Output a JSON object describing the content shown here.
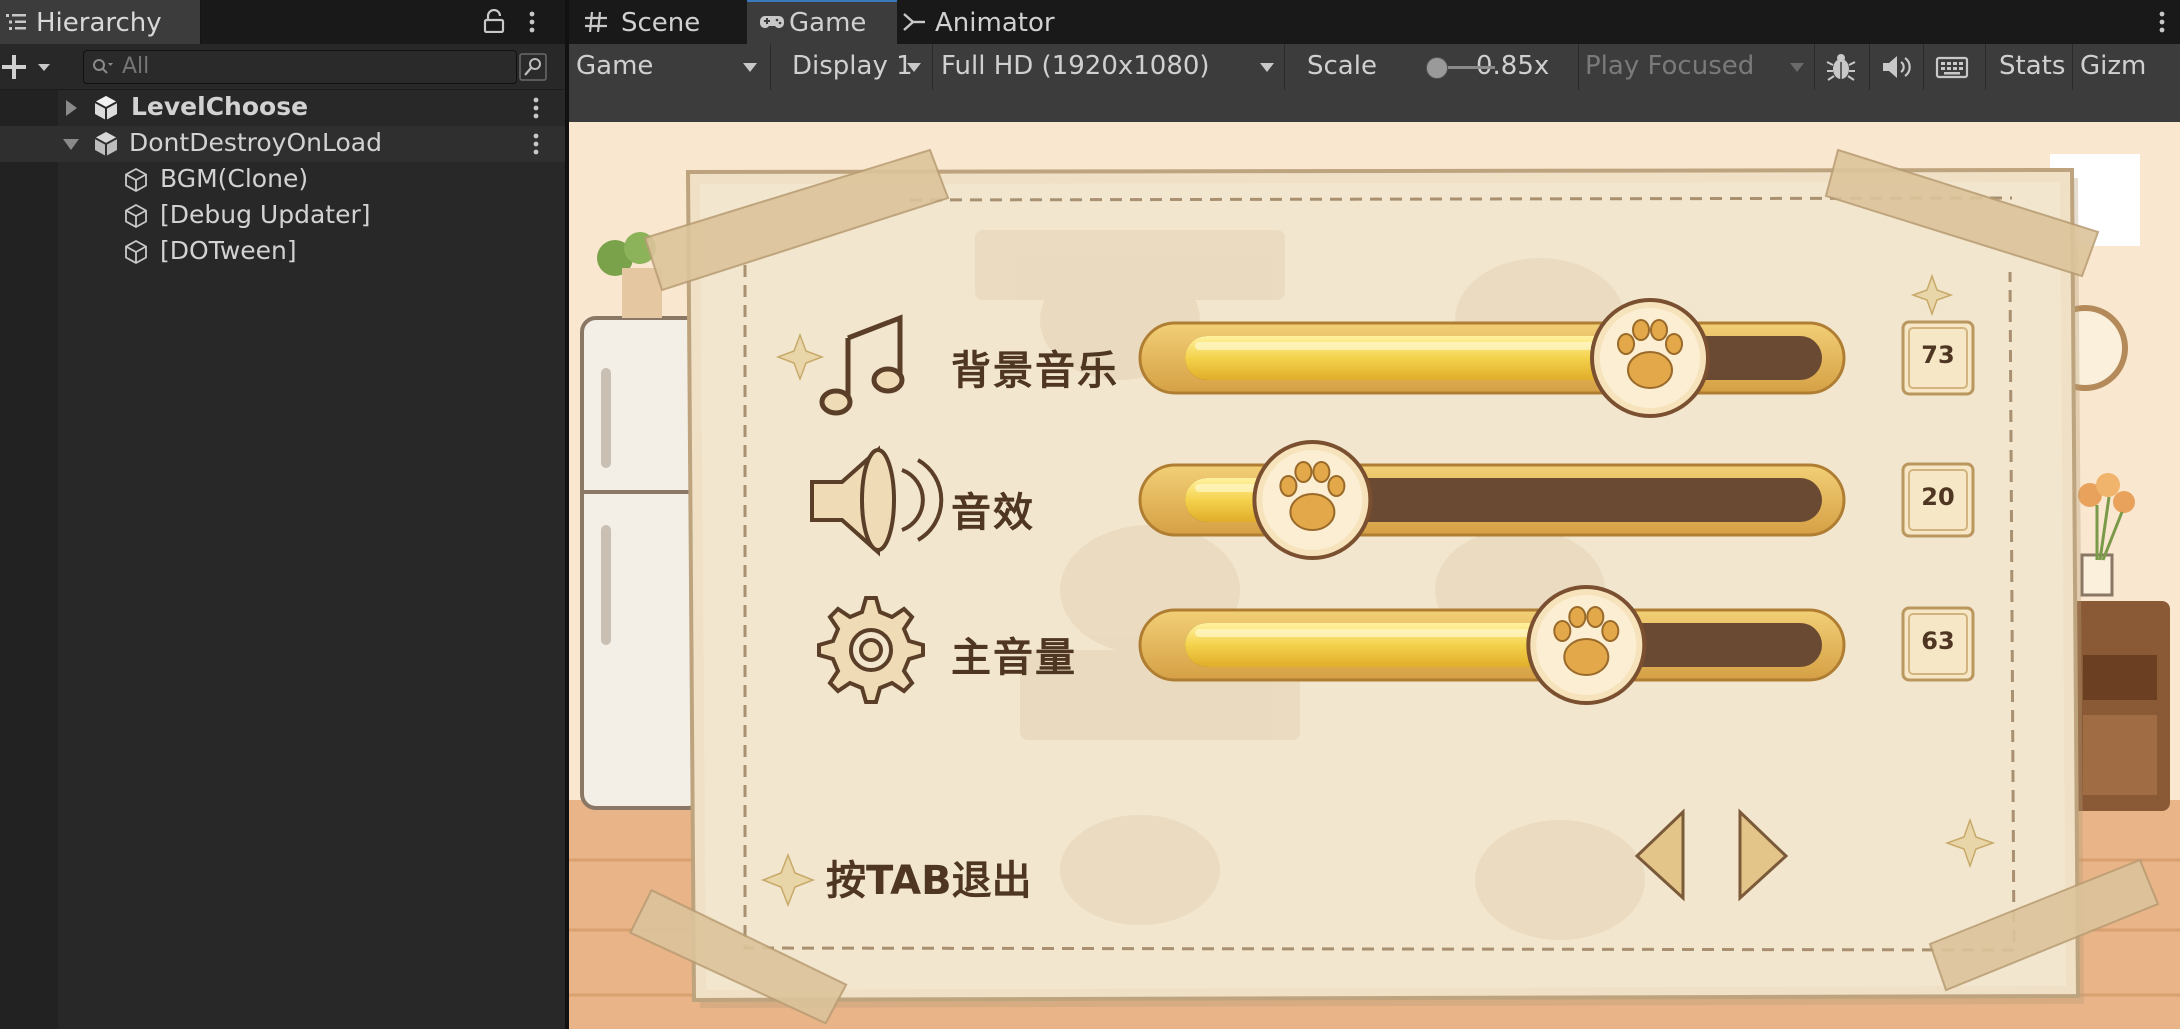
{
  "hierarchy": {
    "tab_label": "Hierarchy",
    "search_placeholder": "All",
    "items": [
      {
        "name": "LevelChoose",
        "expanded": false,
        "bold": true
      },
      {
        "name": "DontDestroyOnLoad",
        "expanded": true,
        "bold": false,
        "children": [
          "BGM(Clone)",
          "[Debug Updater]",
          "[DOTween]"
        ]
      }
    ]
  },
  "tabs": {
    "scene": "Scene",
    "game": "Game",
    "animator": "Animator",
    "active": "Game"
  },
  "game_toolbar": {
    "view_mode": "Game",
    "display": "Display 1",
    "resolution": "Full HD (1920x1080)",
    "scale_label": "Scale",
    "scale_value": "0.85x",
    "play_mode": "Play Focused",
    "stats": "Stats",
    "gizmos": "Gizm"
  },
  "settings_panel": {
    "settings": [
      {
        "label": "背景音乐",
        "value": 73,
        "icon": "music-note-icon"
      },
      {
        "label": "音效",
        "value": 20,
        "icon": "speaker-icon"
      },
      {
        "label": "主音量",
        "value": 63,
        "icon": "gear-icon"
      }
    ],
    "exit_hint": "按TAB退出",
    "nav_prev": "previous-arrow-icon",
    "nav_next": "next-arrow-icon"
  },
  "colors": {
    "editor_bg": "#282828",
    "toolbar_bg": "#3c3c3c",
    "active_tab_accent": "#3a79bb",
    "paper": "#efe0c6",
    "slider_fill": "#f2cc4a",
    "slider_track": "#6a4a32",
    "text_brown": "#4e3622"
  }
}
